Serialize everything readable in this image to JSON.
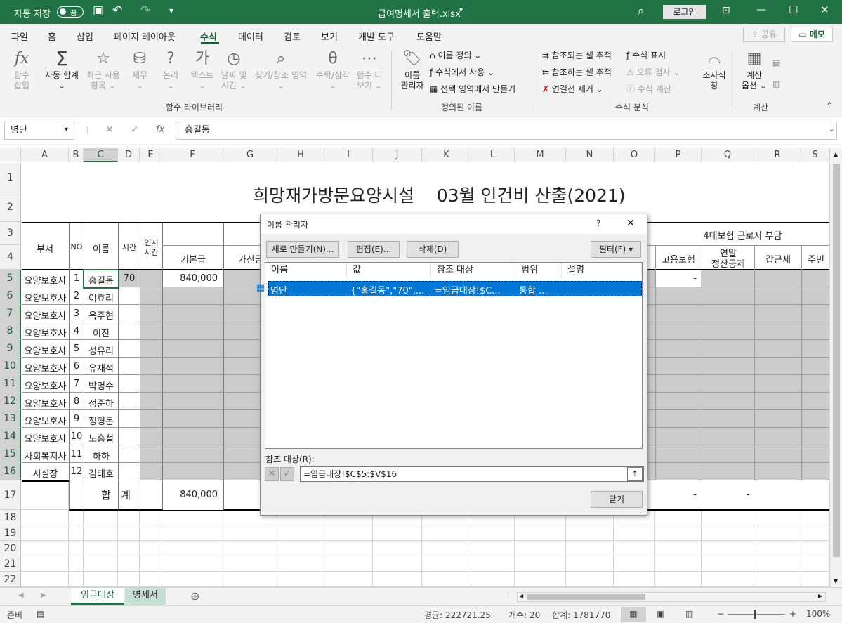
{
  "titlebar": {
    "autosave_label": "자동 저장",
    "toggle_state": "끔",
    "doc_title": "급여명세서 출력.xlsx",
    "login": "로그인"
  },
  "tabs": [
    "파일",
    "홈",
    "삽입",
    "페이지 레이아웃",
    "수식",
    "데이터",
    "검토",
    "보기",
    "개발 도구",
    "도움말"
  ],
  "active_tab": "수식",
  "share": "공유",
  "memo": "메모",
  "ribbon": {
    "insert_fn": [
      "함수",
      "삽입"
    ],
    "autosum": [
      "자동 합계"
    ],
    "recent": [
      "최근 사용",
      "항목"
    ],
    "finance": [
      "재무"
    ],
    "logic": [
      "논리"
    ],
    "text": [
      "텍스트"
    ],
    "datetime": [
      "날짜 및",
      "시간"
    ],
    "lookup": [
      "찾기/참조 영역"
    ],
    "math": [
      "수학/삼각"
    ],
    "more": [
      "함수 더",
      "보기"
    ],
    "group_lib": "함수 라이브러리",
    "name_mgr": [
      "이름",
      "관리자"
    ],
    "define_name": "이름 정의",
    "use_in_formula": "수식에서 사용",
    "create_from_sel": "선택 영역에서 만들기",
    "group_names": "정의된 이름",
    "trace_precedents": "참조되는 셀 추적",
    "trace_dependents": "참조하는 셀 추적",
    "remove_arrows": "연결선 제거",
    "show_formulas": "수식 표시",
    "error_check": "오류 검사",
    "evaluate": "수식 계산",
    "watch": [
      "조사식",
      "창"
    ],
    "group_audit": "수식 분석",
    "calc_options": [
      "계산",
      "옵션"
    ],
    "group_calc": "계산"
  },
  "formula_bar": {
    "name_box": "명단",
    "formula": "홍길동"
  },
  "columns": [
    "A",
    "B",
    "C",
    "D",
    "E",
    "F",
    "G",
    "H",
    "I",
    "J",
    "K",
    "L",
    "M",
    "N",
    "O",
    "P",
    "Q",
    "R",
    "S"
  ],
  "rows": [
    "1",
    "2",
    "3",
    "4",
    "5",
    "6",
    "7",
    "8",
    "9",
    "10",
    "11",
    "12",
    "13",
    "14",
    "15",
    "16",
    "17",
    "18",
    "19",
    "20",
    "21",
    "22"
  ],
  "sheet": {
    "title": "희망재가방문요양시설    03월 인건비 산출(2021)",
    "h_dept": "부서",
    "h_no": "NO",
    "h_name": "이름",
    "h_time": "시간",
    "h_cog": [
      "인지",
      "시간"
    ],
    "h_base": "기본급",
    "h_extra": "가산금",
    "h_ins": "4대보험 근로자 부담",
    "h_emp": "고용보험",
    "h_yearend": [
      "연말",
      "정산공제"
    ],
    "h_tax": "갑근세",
    "h_res": "주민",
    "staff": [
      {
        "dept": "요양보호사",
        "no": "1",
        "name": "홍길동"
      },
      {
        "dept": "요양보호사",
        "no": "2",
        "name": "이효리"
      },
      {
        "dept": "요양보호사",
        "no": "3",
        "name": "옥주현"
      },
      {
        "dept": "요양보호사",
        "no": "4",
        "name": "이진"
      },
      {
        "dept": "요양보호사",
        "no": "5",
        "name": "성유리"
      },
      {
        "dept": "요양보호사",
        "no": "6",
        "name": "유재석"
      },
      {
        "dept": "요양보호사",
        "no": "7",
        "name": "박명수"
      },
      {
        "dept": "요양보호사",
        "no": "8",
        "name": "정준하"
      },
      {
        "dept": "요양보호사",
        "no": "9",
        "name": "정형돈"
      },
      {
        "dept": "요양보호사",
        "no": "10",
        "name": "노홍철"
      },
      {
        "dept": "사회복지사",
        "no": "11",
        "name": "하하"
      },
      {
        "dept": "시설장",
        "no": "12",
        "name": "김태호"
      }
    ],
    "r5_time": "70",
    "r5_base": "840,000",
    "r5_emp": "-",
    "total_label": "합   계",
    "total_base": "840,000",
    "total_emp": "-",
    "total_yearend": "-"
  },
  "dialog": {
    "title": "이름 관리자",
    "help": "?",
    "close_x": "✕",
    "new": "새로 만들기(N)...",
    "edit": "편집(E)...",
    "delete": "삭제(D)",
    "filter": "필터(F)",
    "col_name": "이름",
    "col_value": "값",
    "col_ref": "참조 대상",
    "col_scope": "범위",
    "col_desc": "설명",
    "row": {
      "name": "명단",
      "value": "{\"홍길동\",\"70\",...",
      "ref": "=임금대장!$C...",
      "scope": "통합 ..."
    },
    "ref_label": "참조 대상(R):",
    "ref_value": "=임금대장!$C$5:$V$16",
    "close": "닫기"
  },
  "sheet_tabs": [
    "임금대장",
    "명세서"
  ],
  "status": {
    "ready": "준비",
    "avg": "평균: 222721.25",
    "count": "개수: 20",
    "sum": "합계: 1781770",
    "zoom": "100%"
  }
}
